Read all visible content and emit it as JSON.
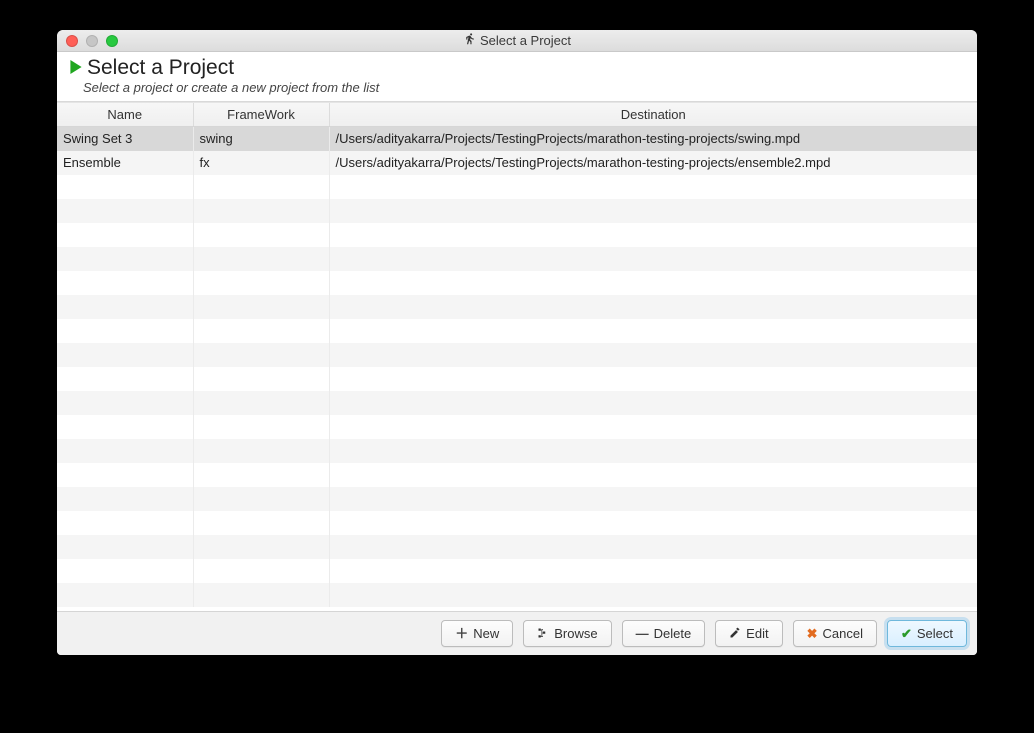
{
  "window": {
    "title": "Select a Project"
  },
  "header": {
    "title": "Select a Project",
    "subtitle": "Select a project or create a new project from the list"
  },
  "table": {
    "columns": {
      "name": "Name",
      "framework": "FrameWork",
      "destination": "Destination"
    },
    "rows": [
      {
        "name": "Swing Set 3",
        "framework": "swing",
        "destination": "/Users/adityakarra/Projects/TestingProjects/marathon-testing-projects/swing.mpd",
        "selected": true
      },
      {
        "name": "Ensemble",
        "framework": "fx",
        "destination": "/Users/adityakarra/Projects/TestingProjects/marathon-testing-projects/ensemble2.mpd",
        "selected": false
      }
    ],
    "blankRows": 18
  },
  "buttons": {
    "new": "New",
    "browse": "Browse",
    "delete": "Delete",
    "edit": "Edit",
    "cancel": "Cancel",
    "select": "Select"
  }
}
